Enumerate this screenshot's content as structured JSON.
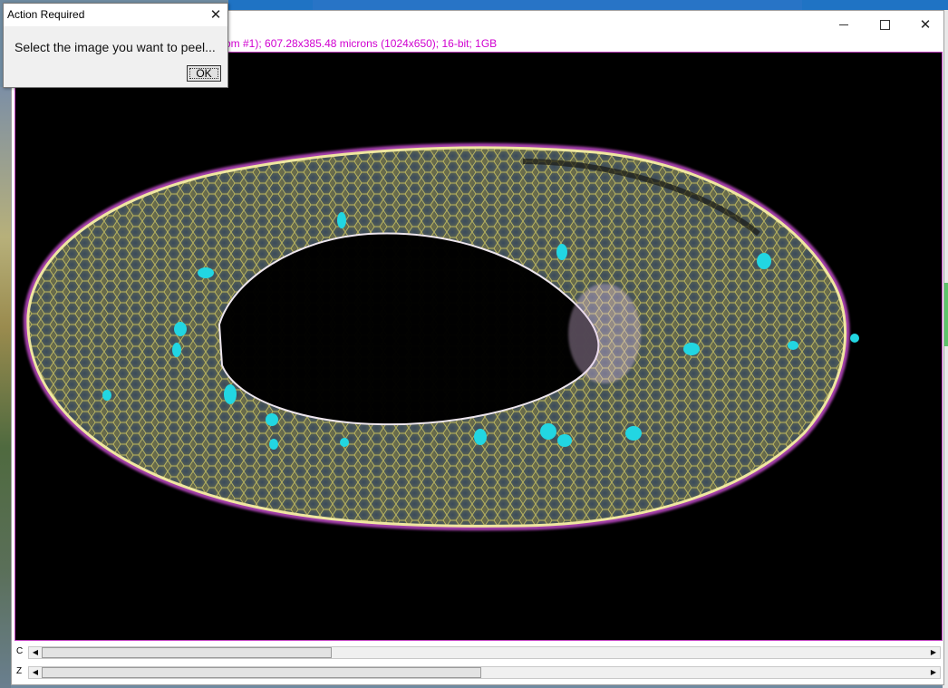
{
  "dialog": {
    "title": "Action Required",
    "message": "Select the image you want to peel...",
    "ok_label": "OK"
  },
  "image_window": {
    "info_line": "om #1); 607.28x385.48 microns (1024x650); 16-bit; 1GB",
    "controls": {
      "minimize_icon": "minimize-icon",
      "maximize_icon": "maximize-icon",
      "close_icon": "close-icon"
    },
    "sliders": [
      {
        "label": "C",
        "position_fraction": 0.33
      },
      {
        "label": "Z",
        "position_fraction": 0.49
      }
    ]
  },
  "colors": {
    "info_text": "#d000d0",
    "canvas_border": "#c040c0",
    "membrane_yellow": "#e0d860",
    "nuclei_cyan": "#20d8e0",
    "edge_magenta": "#d060d0"
  }
}
